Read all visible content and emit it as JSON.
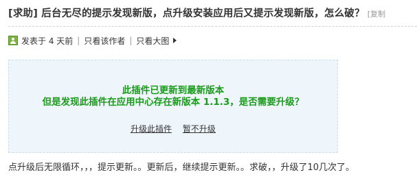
{
  "post": {
    "title": "[求助] 后台无尽的提示发现新版，点升级安装应用后又提示发现新版，怎么破？",
    "copy_label": "[复制"
  },
  "meta": {
    "posted": "发表于 4 天前",
    "separator": "|",
    "only_author": "只看该作者",
    "large_image": "只看大图"
  },
  "notice": {
    "line1": "此插件已更新到最新版本",
    "line2": "但是发现此插件在应用中心存在新版本 1.1.3，是否需要升级？",
    "upgrade_link": "升级此插件",
    "skip_link": "暂不升级"
  },
  "content": {
    "text": "点升级后无限循环，，，提示更新。。更新后，继续提示更新。。求破，，升级了10几次了。"
  },
  "colors": {
    "notice_bg": "#eef6fb",
    "notice_text": "#1a9a1a",
    "user_icon": "#7cb342"
  },
  "icons": {
    "user": "user-icon",
    "arrow": "arrow-right-icon"
  }
}
